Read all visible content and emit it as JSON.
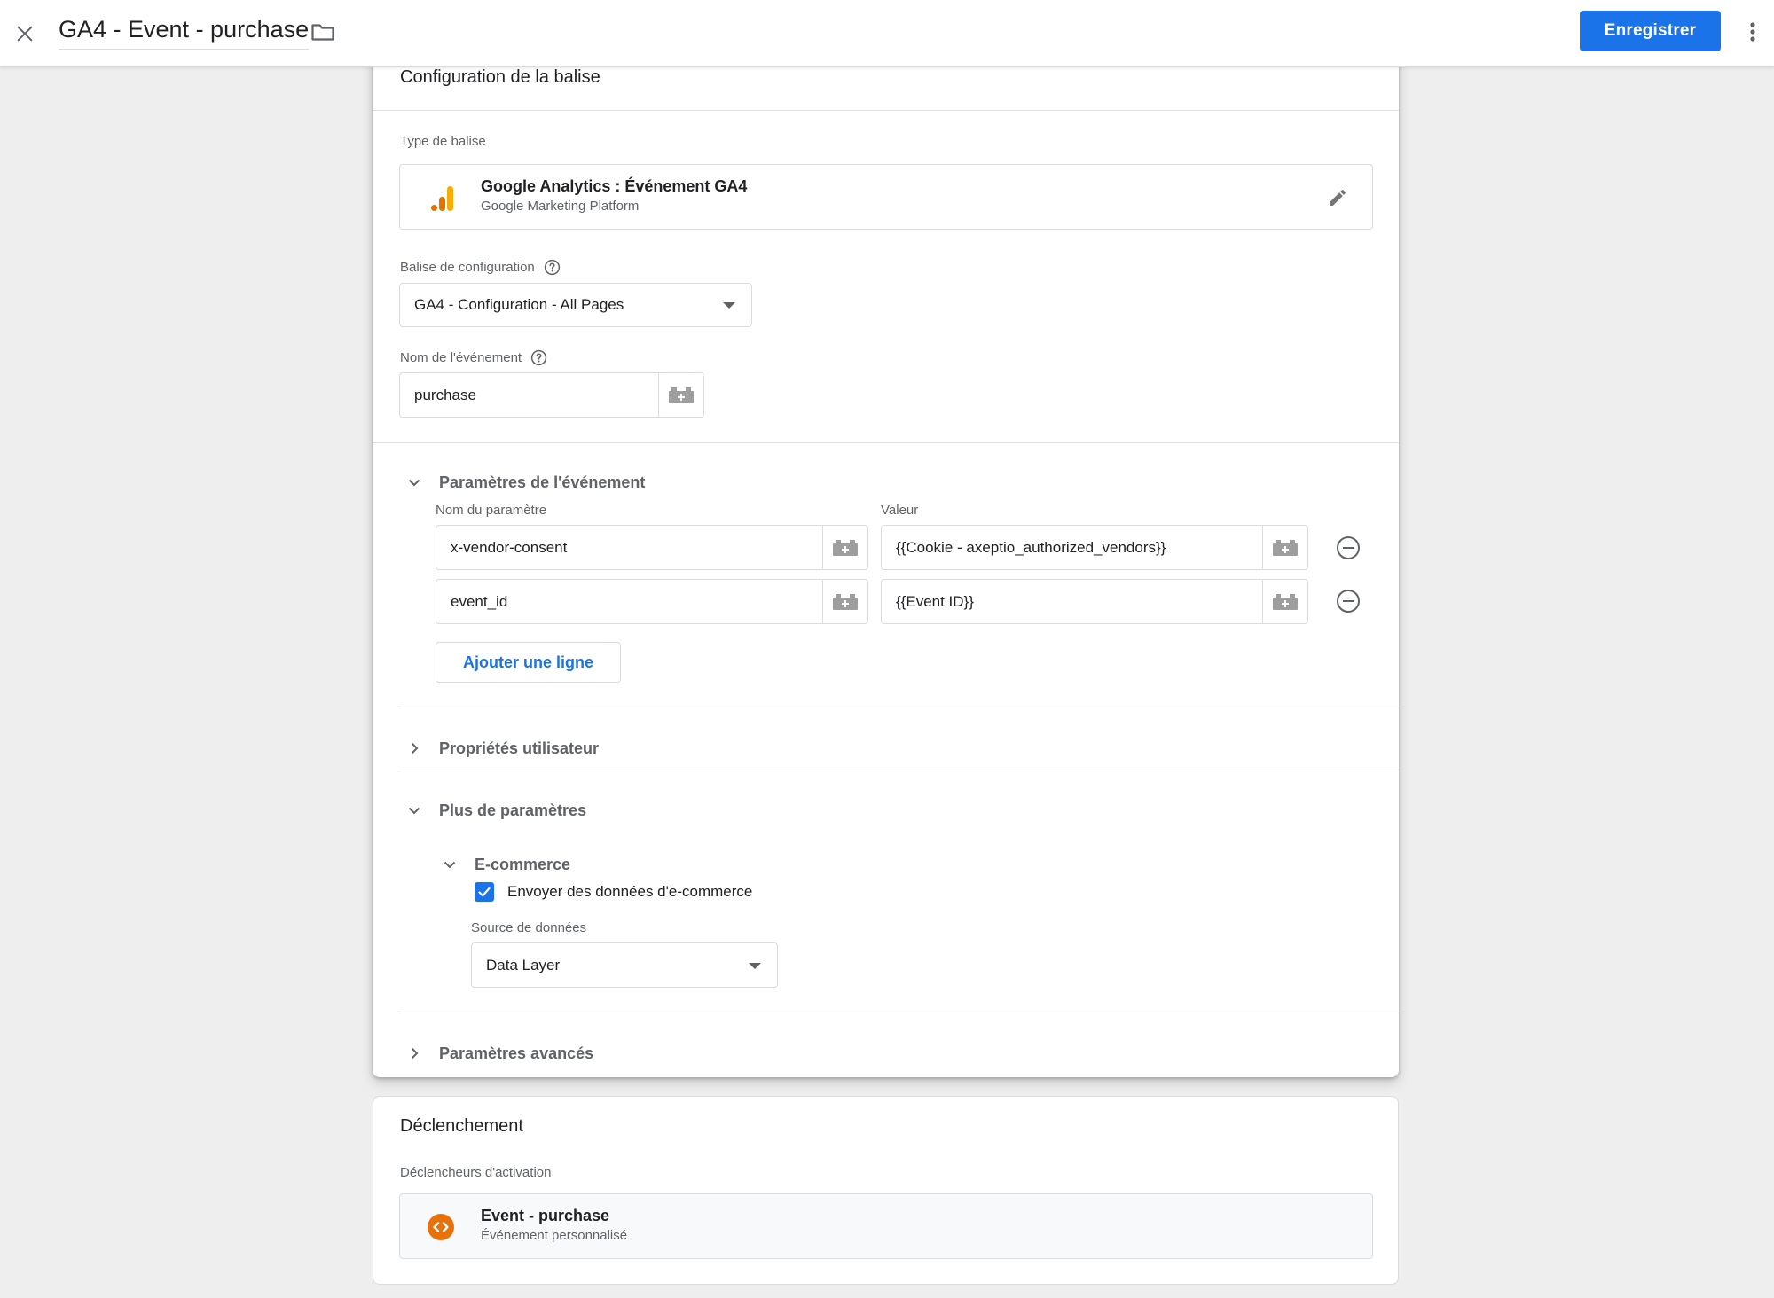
{
  "header": {
    "title": "GA4 - Event - purchase",
    "save_label": "Enregistrer"
  },
  "tag_config": {
    "section_title": "Configuration de la balise",
    "tag_type_label": "Type de balise",
    "tag_type": {
      "name": "Google Analytics : Événement GA4",
      "provider": "Google Marketing Platform"
    },
    "config_tag_label": "Balise de configuration",
    "config_tag_value": "GA4 - Configuration - All Pages",
    "event_name_label": "Nom de l'événement",
    "event_name_value": "purchase",
    "event_params": {
      "title": "Paramètres de l'événement",
      "col_name": "Nom du paramètre",
      "col_value": "Valeur",
      "rows": [
        {
          "name": "x-vendor-consent",
          "value": "{{Cookie - axeptio_authorized_vendors}}"
        },
        {
          "name": "event_id",
          "value": "{{Event ID}}"
        }
      ],
      "add_row_label": "Ajouter une ligne"
    },
    "user_properties_title": "Propriétés utilisateur",
    "more_settings": {
      "title": "Plus de paramètres",
      "ecommerce_title": "E-commerce",
      "send_ecommerce_label": "Envoyer des données d'e-commerce",
      "send_ecommerce_checked": true,
      "data_source_label": "Source de données",
      "data_source_value": "Data Layer"
    },
    "advanced_title": "Paramètres avancés"
  },
  "triggering": {
    "section_title": "Déclenchement",
    "triggers_label": "Déclencheurs d'activation",
    "trigger": {
      "name": "Event - purchase",
      "type": "Événement personnalisé"
    }
  },
  "colors": {
    "primary": "#1a73e8",
    "ga_orange": "#f9ab00",
    "ga_dark_orange": "#e37400",
    "trigger_orange": "#e8710a"
  }
}
